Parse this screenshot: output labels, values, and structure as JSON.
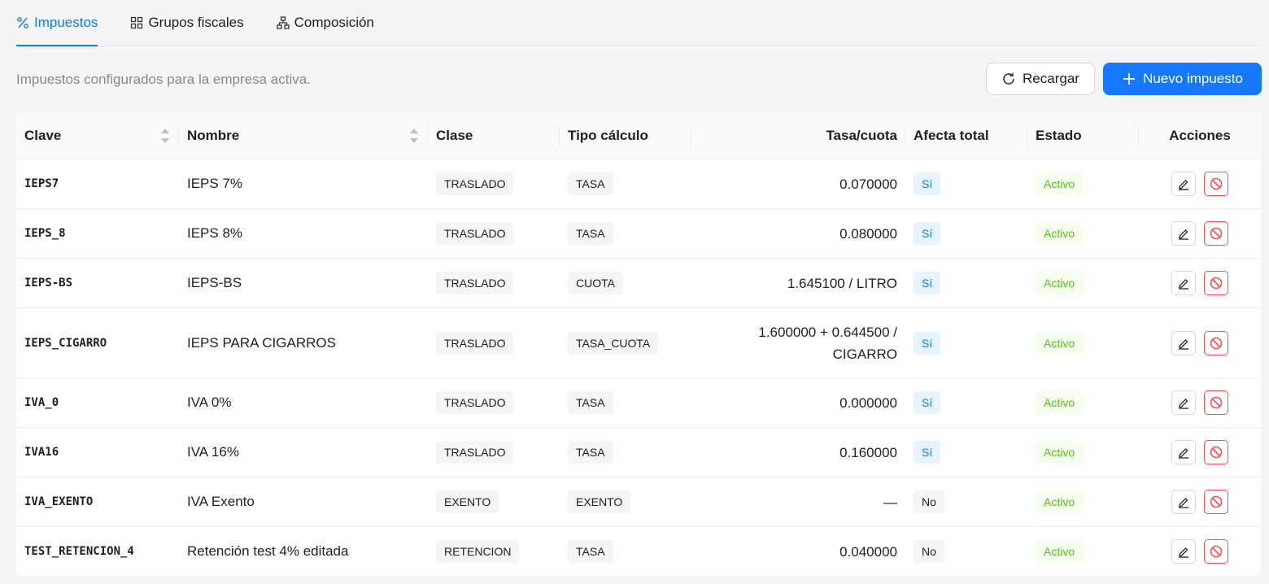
{
  "tabs": [
    {
      "label": "Impuestos",
      "icon": "percent-icon",
      "active": true
    },
    {
      "label": "Grupos fiscales",
      "icon": "grid-icon",
      "active": false
    },
    {
      "label": "Composición",
      "icon": "hierarchy-icon",
      "active": false
    }
  ],
  "subtitle": "Impuestos configurados para la empresa activa.",
  "toolbar": {
    "reload_label": "Recargar",
    "new_label": "Nuevo impuesto"
  },
  "colors": {
    "accent": "#1677ff",
    "success": "#52c41a",
    "danger": "#ff4d4f"
  },
  "table": {
    "headers": {
      "clave": "Clave",
      "nombre": "Nombre",
      "clase": "Clase",
      "tipo": "Tipo cálculo",
      "tasa": "Tasa/cuota",
      "afecta": "Afecta total",
      "estado": "Estado",
      "acciones": "Acciones"
    },
    "rows": [
      {
        "clave": "IEPS7",
        "nombre": "IEPS 7%",
        "clase": "TRASLADO",
        "tipo": "TASA",
        "tasa1": "0.070000",
        "tasa2": "",
        "afecta": "Sí",
        "estado": "Activo"
      },
      {
        "clave": "IEPS_8",
        "nombre": "IEPS 8%",
        "clase": "TRASLADO",
        "tipo": "TASA",
        "tasa1": "0.080000",
        "tasa2": "",
        "afecta": "Sí",
        "estado": "Activo"
      },
      {
        "clave": "IEPS-BS",
        "nombre": "IEPS-BS",
        "clase": "TRASLADO",
        "tipo": "CUOTA",
        "tasa1": "1.645100 / LITRO",
        "tasa2": "",
        "afecta": "Sí",
        "estado": "Activo"
      },
      {
        "clave": "IEPS_CIGARRO",
        "nombre": "IEPS PARA CIGARROS",
        "clase": "TRASLADO",
        "tipo": "TASA_CUOTA",
        "tasa1": "1.600000 + 0.644500 /",
        "tasa2": "CIGARRO",
        "afecta": "Sí",
        "estado": "Activo"
      },
      {
        "clave": "IVA_0",
        "nombre": "IVA 0%",
        "clase": "TRASLADO",
        "tipo": "TASA",
        "tasa1": "0.000000",
        "tasa2": "",
        "afecta": "Sí",
        "estado": "Activo"
      },
      {
        "clave": "IVA16",
        "nombre": "IVA 16%",
        "clase": "TRASLADO",
        "tipo": "TASA",
        "tasa1": "0.160000",
        "tasa2": "",
        "afecta": "Sí",
        "estado": "Activo"
      },
      {
        "clave": "IVA_EXENTO",
        "nombre": "IVA Exento",
        "clase": "EXENTO",
        "tipo": "EXENTO",
        "tasa1": "—",
        "tasa2": "",
        "afecta": "No",
        "estado": "Activo"
      },
      {
        "clave": "TEST_RETENCION_4",
        "nombre": "Retención test 4% editada",
        "clase": "RETENCION",
        "tipo": "TASA",
        "tasa1": "0.040000",
        "tasa2": "",
        "afecta": "No",
        "estado": "Activo"
      }
    ]
  }
}
